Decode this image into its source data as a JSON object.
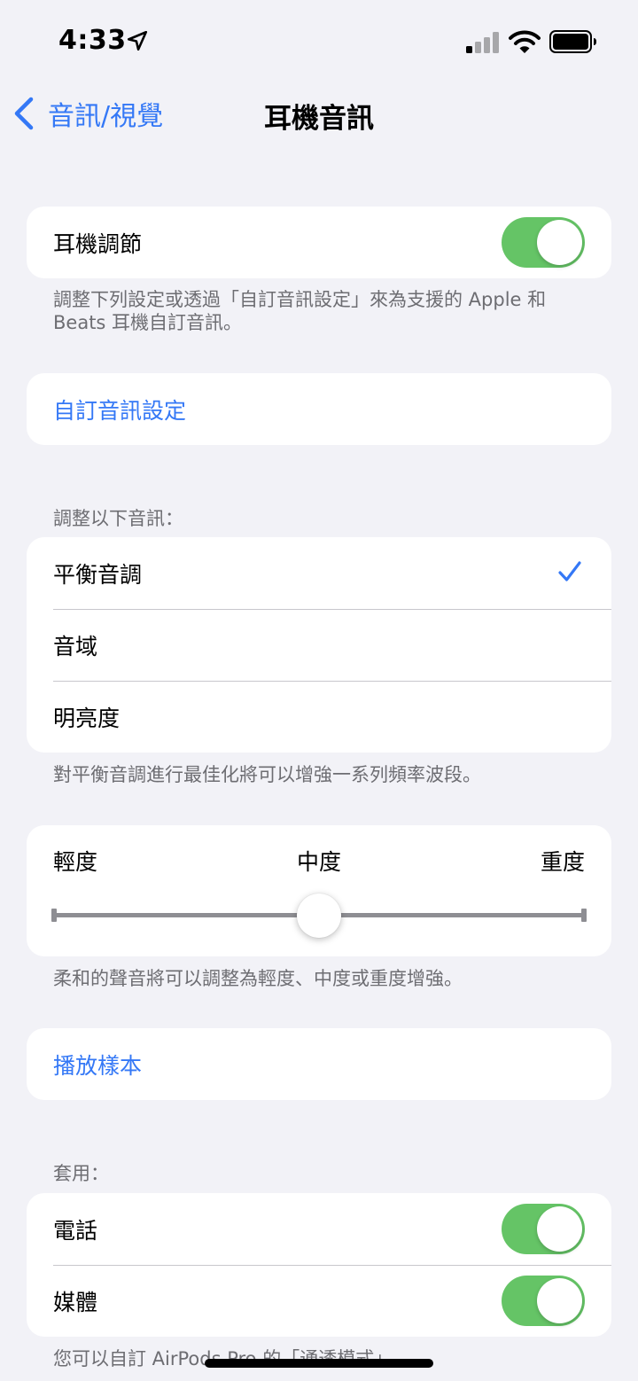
{
  "status_bar": {
    "time": "4:33"
  },
  "nav": {
    "back_label": "音訊/視覺",
    "title": "耳機音訊"
  },
  "headphone_accommodations": {
    "label": "耳機調節",
    "enabled": true,
    "footer": "調整下列設定或透過「自訂音訊設定」來為支援的 Apple 和 Beats 耳機自訂音訊。"
  },
  "custom_setup": {
    "label": "自訂音訊設定"
  },
  "tune_for": {
    "header": "調整以下音訊：",
    "options": [
      {
        "label": "平衡音調",
        "selected": true
      },
      {
        "label": "音域",
        "selected": false
      },
      {
        "label": "明亮度",
        "selected": false
      }
    ],
    "footer": "對平衡音調進行最佳化將可以增強一系列頻率波段。"
  },
  "boost": {
    "labels": {
      "light": "輕度",
      "medium": "中度",
      "heavy": "重度"
    },
    "level": 0.5,
    "footer": "柔和的聲音將可以調整為輕度、中度或重度增強。"
  },
  "play_sample": {
    "label": "播放樣本"
  },
  "apply_with": {
    "header": "套用：",
    "phone": {
      "label": "電話",
      "enabled": true
    },
    "media": {
      "label": "媒體",
      "enabled": true
    },
    "footer": "您可以自訂 AirPods Pro 的「通透模式」。"
  },
  "colors": {
    "accent": "#3478f6",
    "toggle_on": "#65c466",
    "background": "#f2f2f7"
  }
}
